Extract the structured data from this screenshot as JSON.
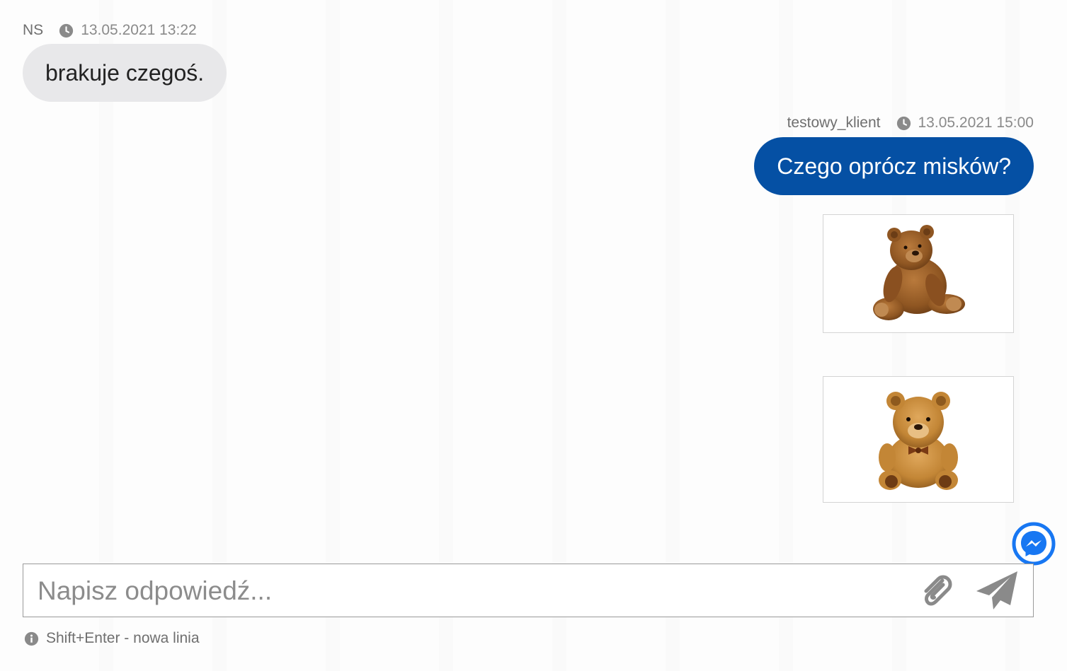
{
  "messages": [
    {
      "author": "NS",
      "timestamp": "13.05.2021 13:22",
      "text": "brakuje czegoś.",
      "direction": "incoming"
    },
    {
      "author": "testowy_klient",
      "timestamp": "13.05.2021 15:00",
      "text": "Czego oprócz misków?",
      "direction": "outgoing",
      "attachments": [
        {
          "icon": "teddy-bear-sitting-image"
        },
        {
          "icon": "teddy-bear-fluffy-image"
        }
      ]
    }
  ],
  "composer": {
    "placeholder": "Napisz odpowiedź...",
    "value": "",
    "attach_icon": "paperclip-icon",
    "send_icon": "send-icon"
  },
  "hint": {
    "icon": "info-icon",
    "text": "Shift+Enter - nowa linia"
  },
  "floating": {
    "icon": "messenger-icon"
  },
  "colors": {
    "outgoing_bubble": "#0550a4",
    "incoming_bubble": "#e8e8ea",
    "messenger_blue": "#1877f2",
    "icon_gray": "#8a8a8a"
  }
}
